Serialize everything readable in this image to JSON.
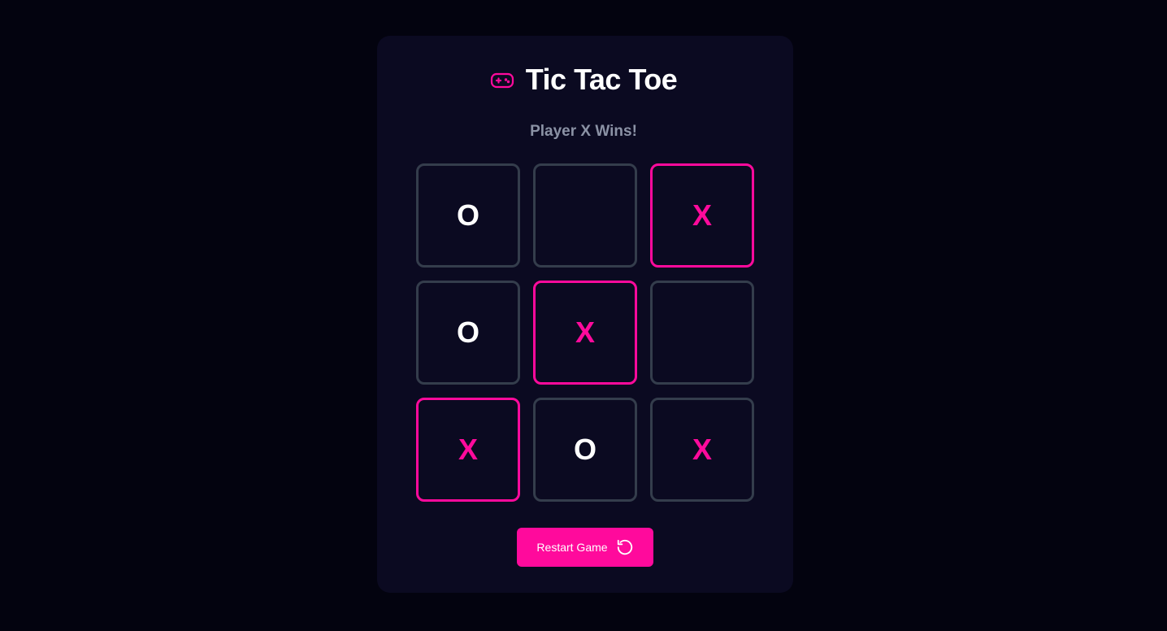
{
  "header": {
    "title": "Tic Tac Toe",
    "icon": "gamepad-icon"
  },
  "status": "Player X Wins!",
  "board": {
    "cells": [
      {
        "mark": "O",
        "winning": false
      },
      {
        "mark": "",
        "winning": false
      },
      {
        "mark": "X",
        "winning": true
      },
      {
        "mark": "O",
        "winning": false
      },
      {
        "mark": "X",
        "winning": true
      },
      {
        "mark": "",
        "winning": false
      },
      {
        "mark": "X",
        "winning": true
      },
      {
        "mark": "O",
        "winning": false
      },
      {
        "mark": "X",
        "winning": false
      }
    ]
  },
  "restart": {
    "label": "Restart Game",
    "icon": "restart-icon"
  },
  "colors": {
    "background": "#03030f",
    "card": "#0b0a21",
    "accent": "#ff0a9c",
    "cell_border": "#343d4c",
    "status_text": "#8b92a5"
  }
}
